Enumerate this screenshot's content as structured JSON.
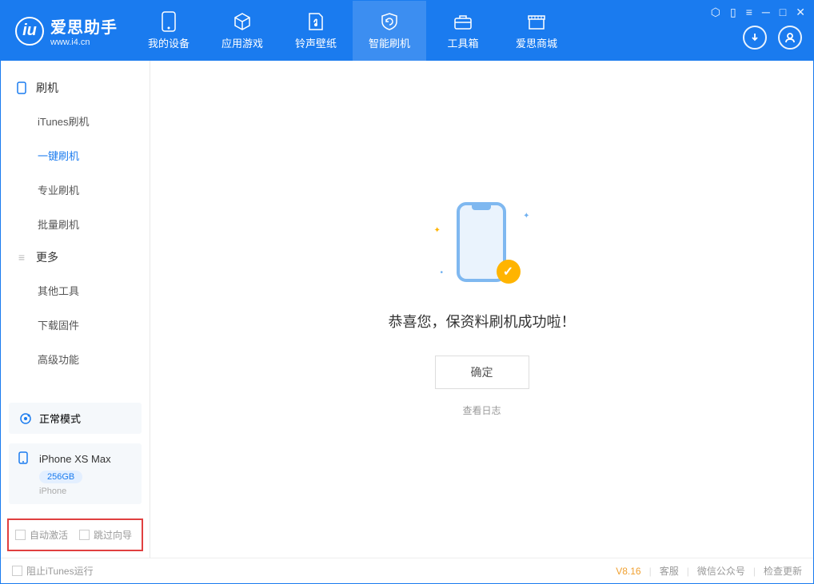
{
  "app": {
    "title": "爱思助手",
    "subtitle": "www.i4.cn"
  },
  "tabs": [
    {
      "label": "我的设备"
    },
    {
      "label": "应用游戏"
    },
    {
      "label": "铃声壁纸"
    },
    {
      "label": "智能刷机"
    },
    {
      "label": "工具箱"
    },
    {
      "label": "爱思商城"
    }
  ],
  "sidebar": {
    "group1": {
      "title": "刷机",
      "items": [
        "iTunes刷机",
        "一键刷机",
        "专业刷机",
        "批量刷机"
      ]
    },
    "group2": {
      "title": "更多",
      "items": [
        "其他工具",
        "下载固件",
        "高级功能"
      ]
    },
    "mode": "正常模式",
    "device": {
      "name": "iPhone XS Max",
      "capacity": "256GB",
      "type": "iPhone"
    },
    "checks": {
      "auto_activate": "自动激活",
      "skip_guide": "跳过向导"
    }
  },
  "main": {
    "success": "恭喜您，保资料刷机成功啦！",
    "ok": "确定",
    "view_log": "查看日志"
  },
  "footer": {
    "block_itunes": "阻止iTunes运行",
    "version": "V8.16",
    "links": [
      "客服",
      "微信公众号",
      "检查更新"
    ]
  }
}
